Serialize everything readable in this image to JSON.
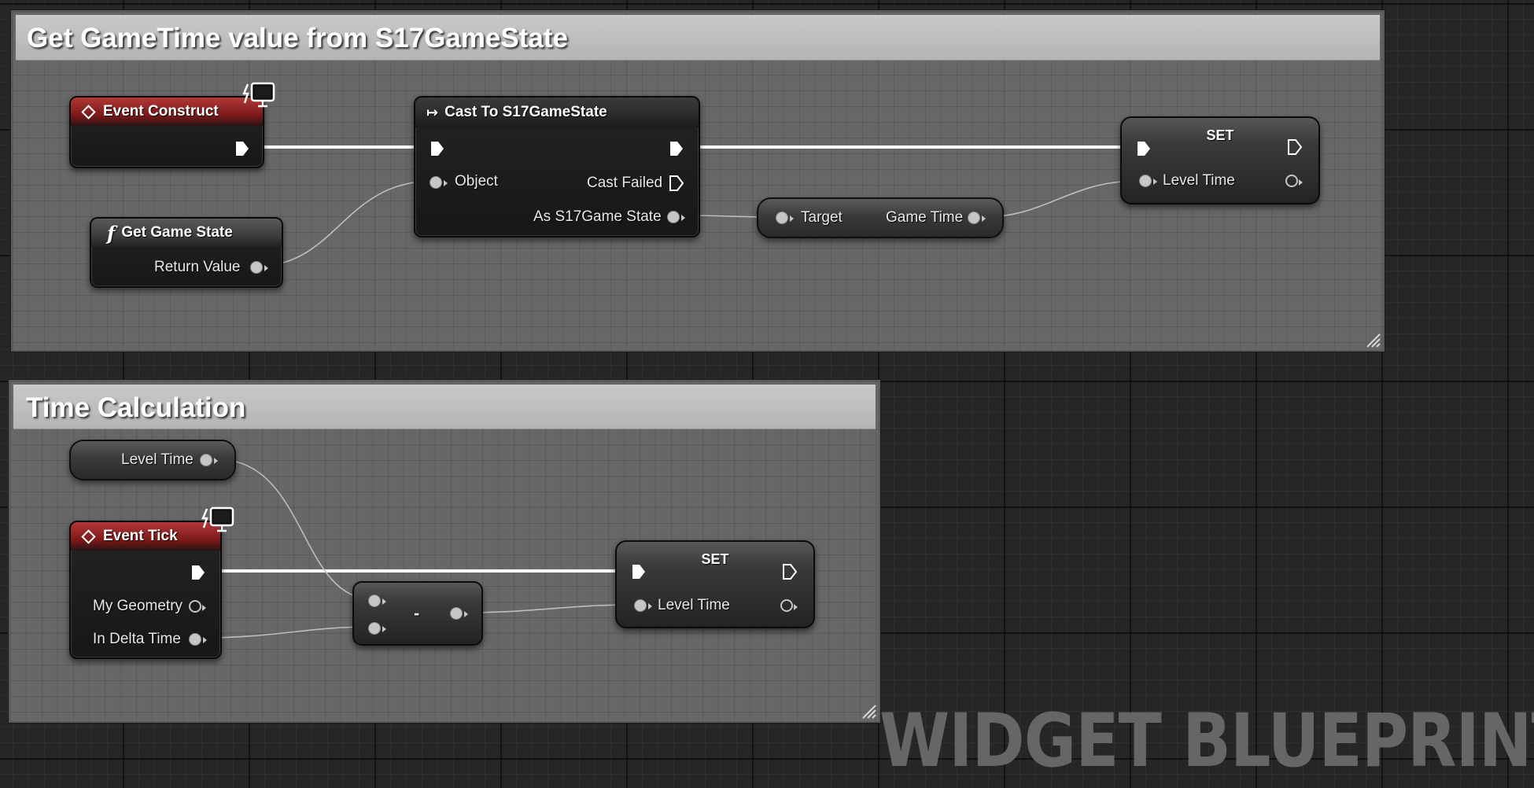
{
  "comments": {
    "gametime": {
      "title": "Get GameTime value from S17GameState"
    },
    "timecalc": {
      "title": "Time Calculation"
    }
  },
  "nodes": {
    "event_construct": {
      "title": "Event Construct",
      "icon": "event-diamond-icon"
    },
    "get_game_state": {
      "title": "Get Game State",
      "icon": "function-icon",
      "pins": {
        "return_value": "Return Value"
      }
    },
    "cast": {
      "title": "Cast To S17GameState",
      "icon": "cast-arrow-icon",
      "pins": {
        "object": "Object",
        "cast_failed": "Cast Failed",
        "as_state": "As S17Game State"
      }
    },
    "get_game_time": {
      "pins": {
        "target": "Target",
        "game_time": "Game Time"
      }
    },
    "set_top": {
      "title": "SET",
      "pins": {
        "level_time": "Level Time"
      }
    },
    "level_time_getter": {
      "label": "Level Time"
    },
    "event_tick": {
      "title": "Event Tick",
      "icon": "event-diamond-icon",
      "pins": {
        "my_geometry": "My Geometry",
        "in_delta_time": "In Delta Time"
      }
    },
    "subtract": {
      "symbol": "-"
    },
    "set_bottom": {
      "title": "SET",
      "pins": {
        "level_time": "Level Time"
      }
    }
  },
  "watermark": "WIDGET BLUEPRINT",
  "colors": {
    "graph_background": "#262626",
    "comment_body": "#767676",
    "comment_header": "#c0c0c0",
    "event_header": "#9a2424",
    "exec_wire": "#ffffff",
    "data_wire": "#bdbdbd",
    "watermark": "#6a6a6a"
  }
}
